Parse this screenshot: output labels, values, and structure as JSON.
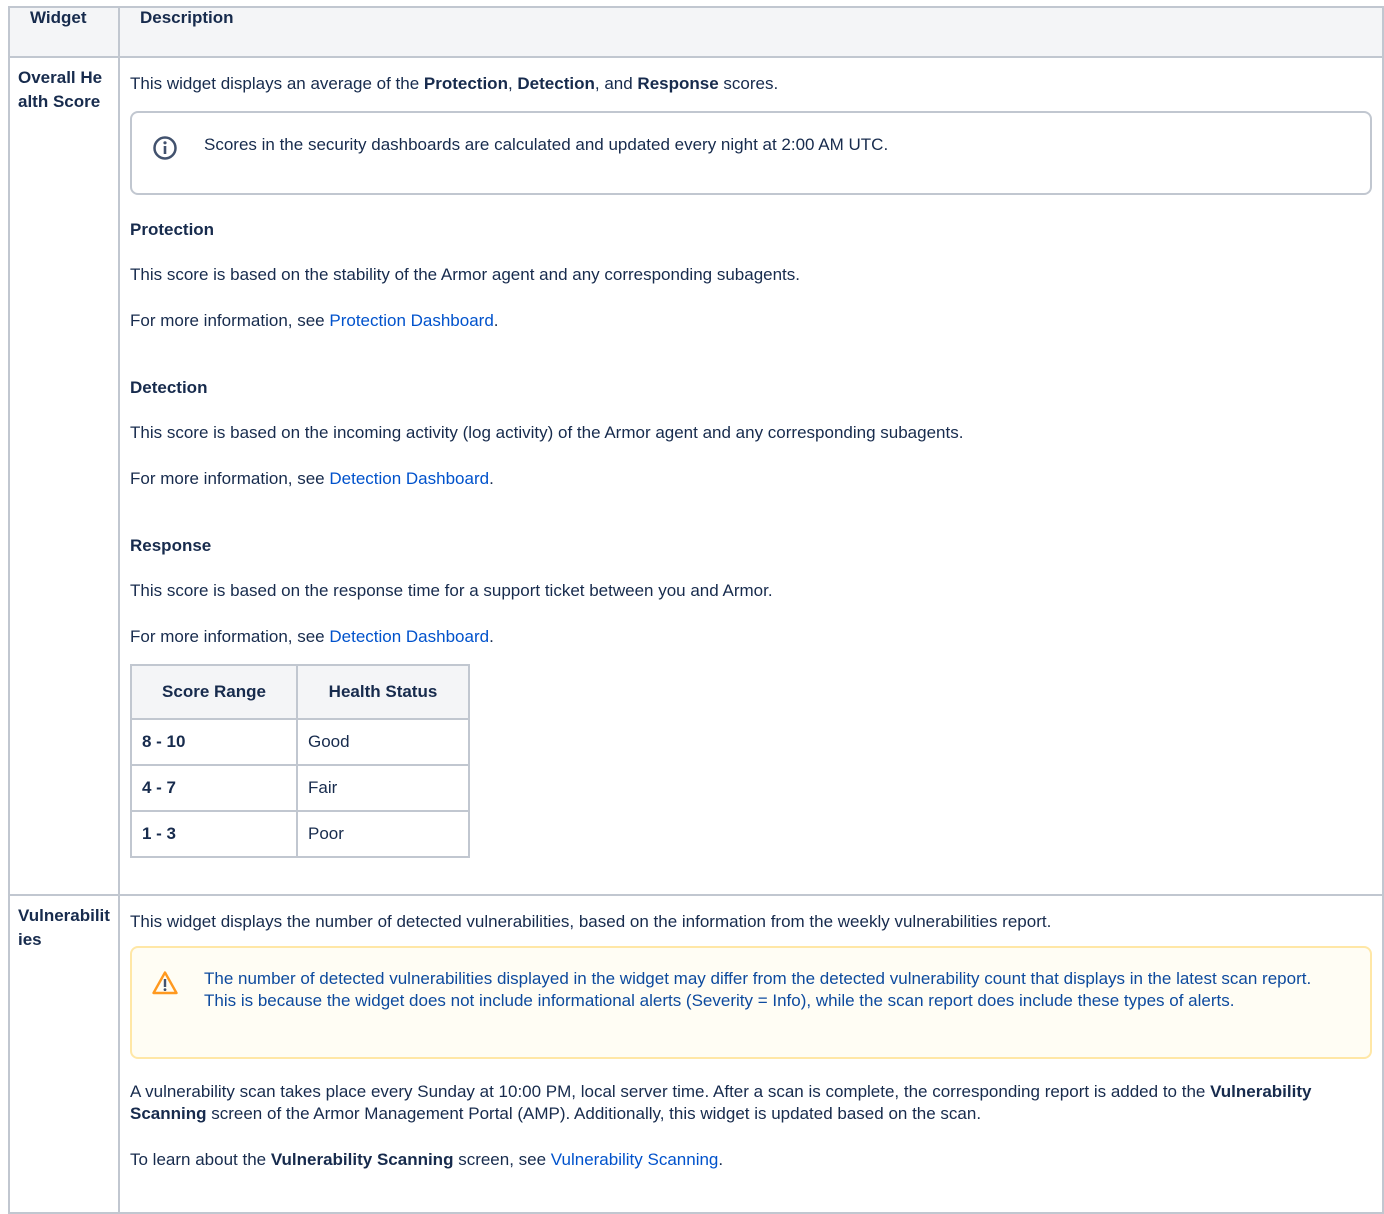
{
  "header": {
    "widget": "Widget",
    "description": "Description"
  },
  "health": {
    "widget_label": "Overall Health Score",
    "intro_pre": "This widget displays an average of the ",
    "intro_b1": "Protection",
    "intro_sep1": ", ",
    "intro_b2": "Detection",
    "intro_sep2": ", and ",
    "intro_b3": "Response",
    "intro_post": " scores.",
    "info_note": "Scores in the security dashboards are calculated and updated every night at 2:00 AM UTC.",
    "protection": {
      "heading": "Protection",
      "text": "This score is based on the stability of the Armor agent and any corresponding subagents.",
      "more_pre": "For more information, see ",
      "link": "Protection Dashboard",
      "more_post": "."
    },
    "detection": {
      "heading": "Detection",
      "text": "This score is based on the incoming activity (log activity) of the Armor agent and any corresponding subagents.",
      "more_pre": "For more information, see ",
      "link": "Detection Dashboard",
      "more_post": "."
    },
    "response": {
      "heading": "Response",
      "text": "This score is based on the response time for a support ticket between you and Armor.",
      "more_pre": "For more information, see ",
      "link": "Detection Dashboard",
      "more_post": "."
    },
    "score_table": {
      "headers": [
        "Score Range",
        "Health Status"
      ],
      "rows": [
        {
          "range": "8 - 10",
          "status": "Good"
        },
        {
          "range": "4 - 7",
          "status": "Fair"
        },
        {
          "range": "1 - 3",
          "status": "Poor"
        }
      ]
    }
  },
  "vuln": {
    "widget_label": "Vulnerabilities",
    "intro": "This widget displays the number of detected vulnerabilities, based on the information from the weekly vulnerabilities report.",
    "warn_note": "The number of detected vulnerabilities displayed in the widget may differ from the detected vulnerability count that displays in the latest scan report. This is because the widget does not include informational alerts (Severity = Info), while the scan report does include these types of alerts.",
    "scan_pre": "A vulnerability scan takes place every Sunday at 10:00 PM, local server time. After a scan is complete, the corresponding report is added to the ",
    "scan_b": "Vulnerability Scanning",
    "scan_post": " screen of the Armor Management Portal (AMP). Additionally, this widget is updated based on the scan.",
    "learn_pre": "To learn about the ",
    "learn_b": "Vulnerability Scanning",
    "learn_mid": " screen, see ",
    "learn_link": "Vulnerability Scanning",
    "learn_post": "."
  },
  "colors": {
    "link": "#0052cc",
    "border": "#c1c7d0",
    "header_bg": "#f4f5f7",
    "warn_border": "#ffe7a6",
    "warn_bg": "#fffdf4"
  },
  "icons": {
    "info": "info-icon",
    "warning": "warning-icon"
  }
}
